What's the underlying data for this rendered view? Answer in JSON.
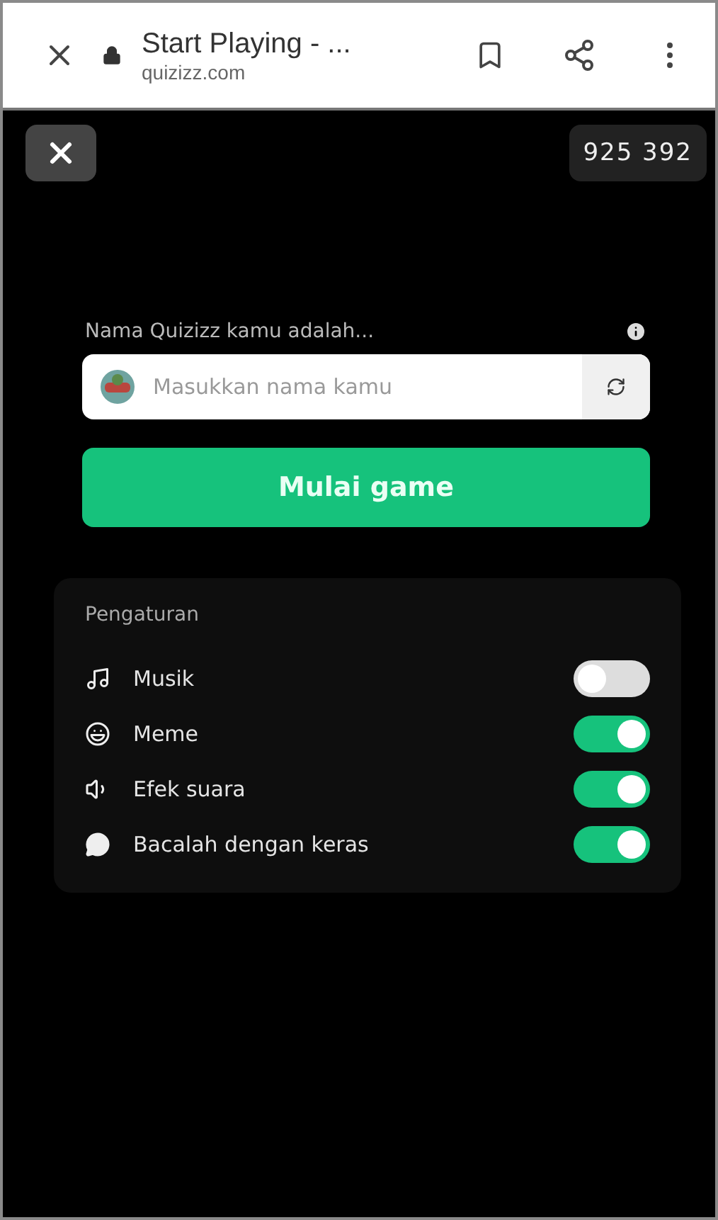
{
  "browser_bar": {
    "title": "Start Playing - ...",
    "url": "quizizz.com"
  },
  "game_code": "925 392",
  "name_form": {
    "label": "Nama Quizizz kamu adalah...",
    "placeholder": "Masukkan nama kamu"
  },
  "start_button": "Mulai game",
  "settings": {
    "title": "Pengaturan",
    "items": [
      {
        "label": "Musik",
        "on": false
      },
      {
        "label": "Meme",
        "on": true
      },
      {
        "label": "Efek suara",
        "on": true
      },
      {
        "label": "Bacalah dengan keras",
        "on": true
      }
    ]
  }
}
